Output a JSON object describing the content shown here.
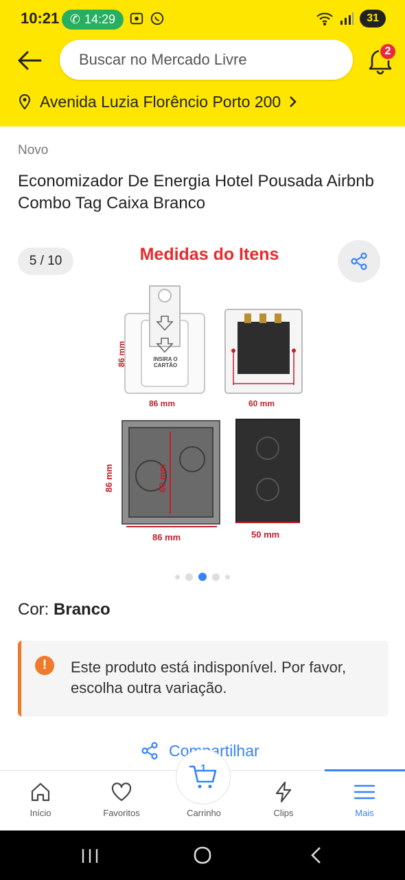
{
  "status_bar": {
    "time": "10:21",
    "call_time": "14:29",
    "battery": "31"
  },
  "header": {
    "search_placeholder": "Buscar no Mercado Livre",
    "notification_count": "2",
    "address": "Avenida Luzia Florêncio Porto 200"
  },
  "product": {
    "condition": "Novo",
    "title": "Economizador De Energia Hotel Pousada Airbnb Combo Tag Caixa Branco",
    "image_counter": "5 / 10",
    "image": {
      "title": "Medidas do Itens",
      "card_text": "INSIRA O CARTÃO",
      "dims": {
        "switch_h": "86 mm",
        "switch_w": "86 mm",
        "back_w": "60 mm",
        "box_h": "86 mm",
        "box_inner": "60 mm",
        "box_w": "86 mm",
        "side_w": "50 mm"
      }
    },
    "carousel": {
      "total": 5,
      "active_index": 2
    },
    "color_label": "Cor:",
    "color_value": "Branco",
    "alert_text": "Este produto está indisponível. Por favor, escolha outra variação.",
    "share_label": "Compartilhar"
  },
  "bottom_nav": {
    "items": [
      {
        "label": "Início",
        "icon": "home-icon"
      },
      {
        "label": "Favoritos",
        "icon": "heart-icon"
      },
      {
        "label": "Carrinho",
        "icon": "cart-icon"
      },
      {
        "label": "Clips",
        "icon": "lightning-icon"
      },
      {
        "label": "Mais",
        "icon": "menu-icon"
      }
    ],
    "active": "Mais",
    "cart_count": "1"
  },
  "colors": {
    "brand_yellow": "#FFE600",
    "link_blue": "#3483fa",
    "warning_orange": "#f07a2b",
    "badge_red": "#e8283f"
  }
}
